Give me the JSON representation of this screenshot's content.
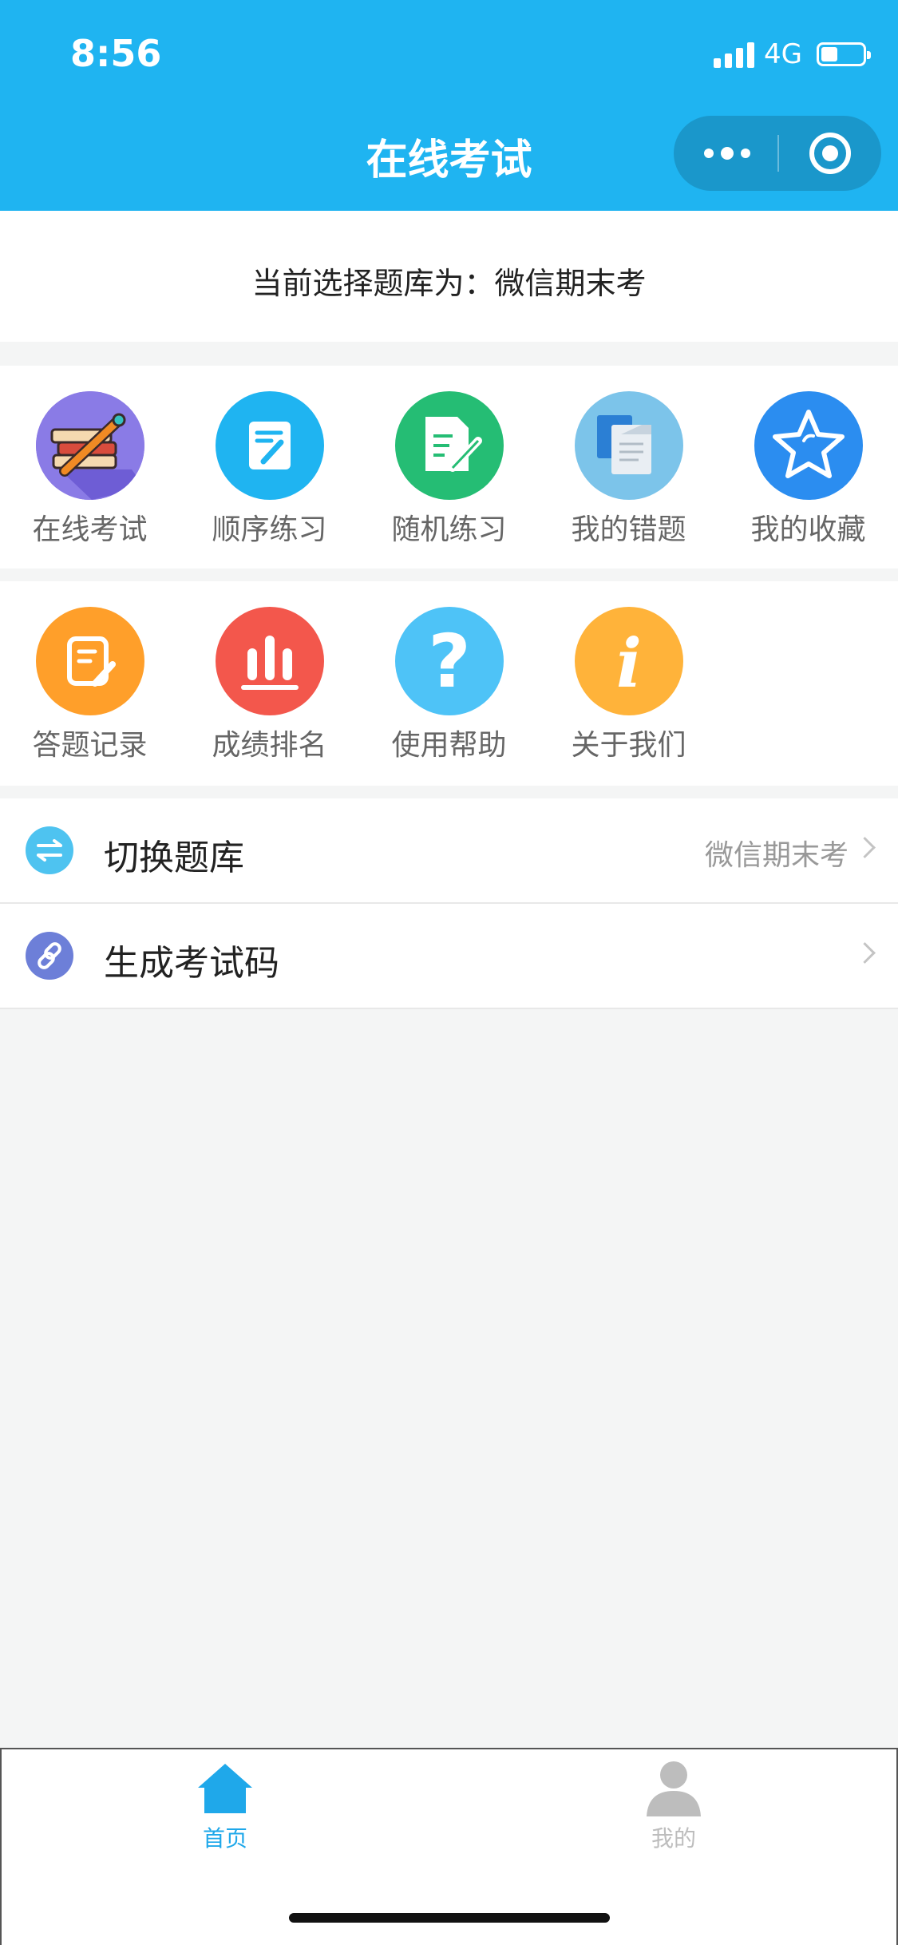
{
  "status_bar": {
    "time": "8:56",
    "network": "4G",
    "battery_level": 0.3
  },
  "nav": {
    "title": "在线考试"
  },
  "current_bank": {
    "text": "当前选择题库为：微信期末考"
  },
  "grid_row1": [
    {
      "label": "在线考试",
      "icon": "books-pencil-icon",
      "color": "#7a5fe0"
    },
    {
      "label": "顺序练习",
      "icon": "note-edit-icon",
      "color": "#1fb4f1"
    },
    {
      "label": "随机练习",
      "icon": "document-edit-icon",
      "color": "#25bd74"
    },
    {
      "label": "我的错题",
      "icon": "documents-icon",
      "color": "#7cc4ea"
    },
    {
      "label": "我的收藏",
      "icon": "star-icon",
      "color": "#2b8df0"
    }
  ],
  "grid_row2": [
    {
      "label": "答题记录",
      "icon": "record-edit-icon",
      "color": "#ff9f2a"
    },
    {
      "label": "成绩排名",
      "icon": "bar-chart-icon",
      "color": "#f3574c"
    },
    {
      "label": "使用帮助",
      "icon": "question-icon",
      "color": "#4ec3f7"
    },
    {
      "label": "关于我们",
      "icon": "info-icon",
      "color": "#ffb33a"
    }
  ],
  "list": [
    {
      "label": "切换题库",
      "value": "微信期末考",
      "icon": "switch-icon",
      "color": "#4ec3f0"
    },
    {
      "label": "生成考试码",
      "value": "",
      "icon": "link-icon",
      "color": "#6d7fd8"
    }
  ],
  "tabs": [
    {
      "label": "首页",
      "icon": "home-icon",
      "active": true,
      "color": "#1fa8ea"
    },
    {
      "label": "我的",
      "icon": "user-icon",
      "active": false,
      "color": "#bdbdbd"
    }
  ]
}
